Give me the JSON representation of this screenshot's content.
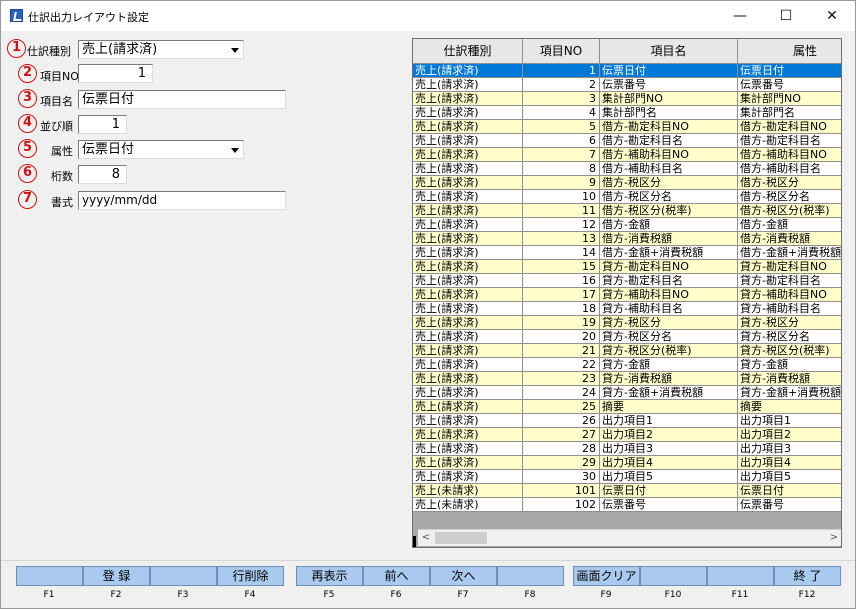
{
  "window": {
    "title": "仕訳出力レイアウト設定",
    "min": "—",
    "max": "☐",
    "close": "✕"
  },
  "form": {
    "f1": {
      "num": "1",
      "label": "仕訳種別",
      "value": "売上(請求済)"
    },
    "f2": {
      "num": "2",
      "label": "項目NO",
      "value": "1"
    },
    "f3": {
      "num": "3",
      "label": "項目名",
      "value": "伝票日付"
    },
    "f4": {
      "num": "4",
      "label": "並び順",
      "value": "1"
    },
    "f5": {
      "num": "5",
      "label": "属性",
      "value": "伝票日付"
    },
    "f6": {
      "num": "6",
      "label": "桁数",
      "value": "8"
    },
    "f7": {
      "num": "7",
      "label": "書式",
      "value": "yyyy/mm/dd"
    }
  },
  "grid": {
    "headers": [
      "仕訳種別",
      "項目NO",
      "項目名",
      "属性"
    ],
    "rows": [
      [
        "売上(請求済)",
        "1",
        "伝票日付",
        "伝票日付"
      ],
      [
        "売上(請求済)",
        "2",
        "伝票番号",
        "伝票番号"
      ],
      [
        "売上(請求済)",
        "3",
        "集計部門NO",
        "集計部門NO"
      ],
      [
        "売上(請求済)",
        "4",
        "集計部門名",
        "集計部門名"
      ],
      [
        "売上(請求済)",
        "5",
        "借方-勘定科目NO",
        "借方-勘定科目NO"
      ],
      [
        "売上(請求済)",
        "6",
        "借方-勘定科目名",
        "借方-勘定科目名"
      ],
      [
        "売上(請求済)",
        "7",
        "借方-補助科目NO",
        "借方-補助科目NO"
      ],
      [
        "売上(請求済)",
        "8",
        "借方-補助科目名",
        "借方-補助科目名"
      ],
      [
        "売上(請求済)",
        "9",
        "借方-税区分",
        "借方-税区分"
      ],
      [
        "売上(請求済)",
        "10",
        "借方-税区分名",
        "借方-税区分名"
      ],
      [
        "売上(請求済)",
        "11",
        "借方-税区分(税率)",
        "借方-税区分(税率)"
      ],
      [
        "売上(請求済)",
        "12",
        "借方-金額",
        "借方-金額"
      ],
      [
        "売上(請求済)",
        "13",
        "借方-消費税額",
        "借方-消費税額"
      ],
      [
        "売上(請求済)",
        "14",
        "借方-金額+消費税額",
        "借方-金額+消費税額"
      ],
      [
        "売上(請求済)",
        "15",
        "貸方-勘定科目NO",
        "貸方-勘定科目NO"
      ],
      [
        "売上(請求済)",
        "16",
        "貸方-勘定科目名",
        "貸方-勘定科目名"
      ],
      [
        "売上(請求済)",
        "17",
        "貸方-補助科目NO",
        "貸方-補助科目NO"
      ],
      [
        "売上(請求済)",
        "18",
        "貸方-補助科目名",
        "貸方-補助科目名"
      ],
      [
        "売上(請求済)",
        "19",
        "貸方-税区分",
        "貸方-税区分"
      ],
      [
        "売上(請求済)",
        "20",
        "貸方-税区分名",
        "貸方-税区分名"
      ],
      [
        "売上(請求済)",
        "21",
        "貸方-税区分(税率)",
        "貸方-税区分(税率)"
      ],
      [
        "売上(請求済)",
        "22",
        "貸方-金額",
        "貸方-金額"
      ],
      [
        "売上(請求済)",
        "23",
        "貸方-消費税額",
        "貸方-消費税額"
      ],
      [
        "売上(請求済)",
        "24",
        "貸方-金額+消費税額",
        "貸方-金額+消費税額"
      ],
      [
        "売上(請求済)",
        "25",
        "摘要",
        "摘要"
      ],
      [
        "売上(請求済)",
        "26",
        "出力項目1",
        "出力項目1"
      ],
      [
        "売上(請求済)",
        "27",
        "出力項目2",
        "出力項目2"
      ],
      [
        "売上(請求済)",
        "28",
        "出力項目3",
        "出力項目3"
      ],
      [
        "売上(請求済)",
        "29",
        "出力項目4",
        "出力項目4"
      ],
      [
        "売上(請求済)",
        "30",
        "出力項目5",
        "出力項目5"
      ],
      [
        "売上(未請求)",
        "101",
        "伝票日付",
        "伝票日付"
      ],
      [
        "売上(未請求)",
        "102",
        "伝票番号",
        "伝票番号"
      ]
    ],
    "selected_row": 0,
    "scroll_left": "<",
    "scroll_right": ">"
  },
  "colors": {
    "selected": "#0078d7",
    "odd": "#ffffcc",
    "even": "#ffffff",
    "fkey": "#a9c9ee",
    "circle": "#d01010"
  },
  "fkeys": [
    {
      "key": "F1",
      "label": ""
    },
    {
      "key": "F2",
      "label": "登 録"
    },
    {
      "key": "F3",
      "label": ""
    },
    {
      "key": "F4",
      "label": "行削除"
    },
    {
      "key": "F5",
      "label": "再表示"
    },
    {
      "key": "F6",
      "label": "前へ"
    },
    {
      "key": "F7",
      "label": "次へ"
    },
    {
      "key": "F8",
      "label": ""
    },
    {
      "key": "F9",
      "label": "画面クリア"
    },
    {
      "key": "F10",
      "label": ""
    },
    {
      "key": "F11",
      "label": ""
    },
    {
      "key": "F12",
      "label": "終 了"
    }
  ]
}
